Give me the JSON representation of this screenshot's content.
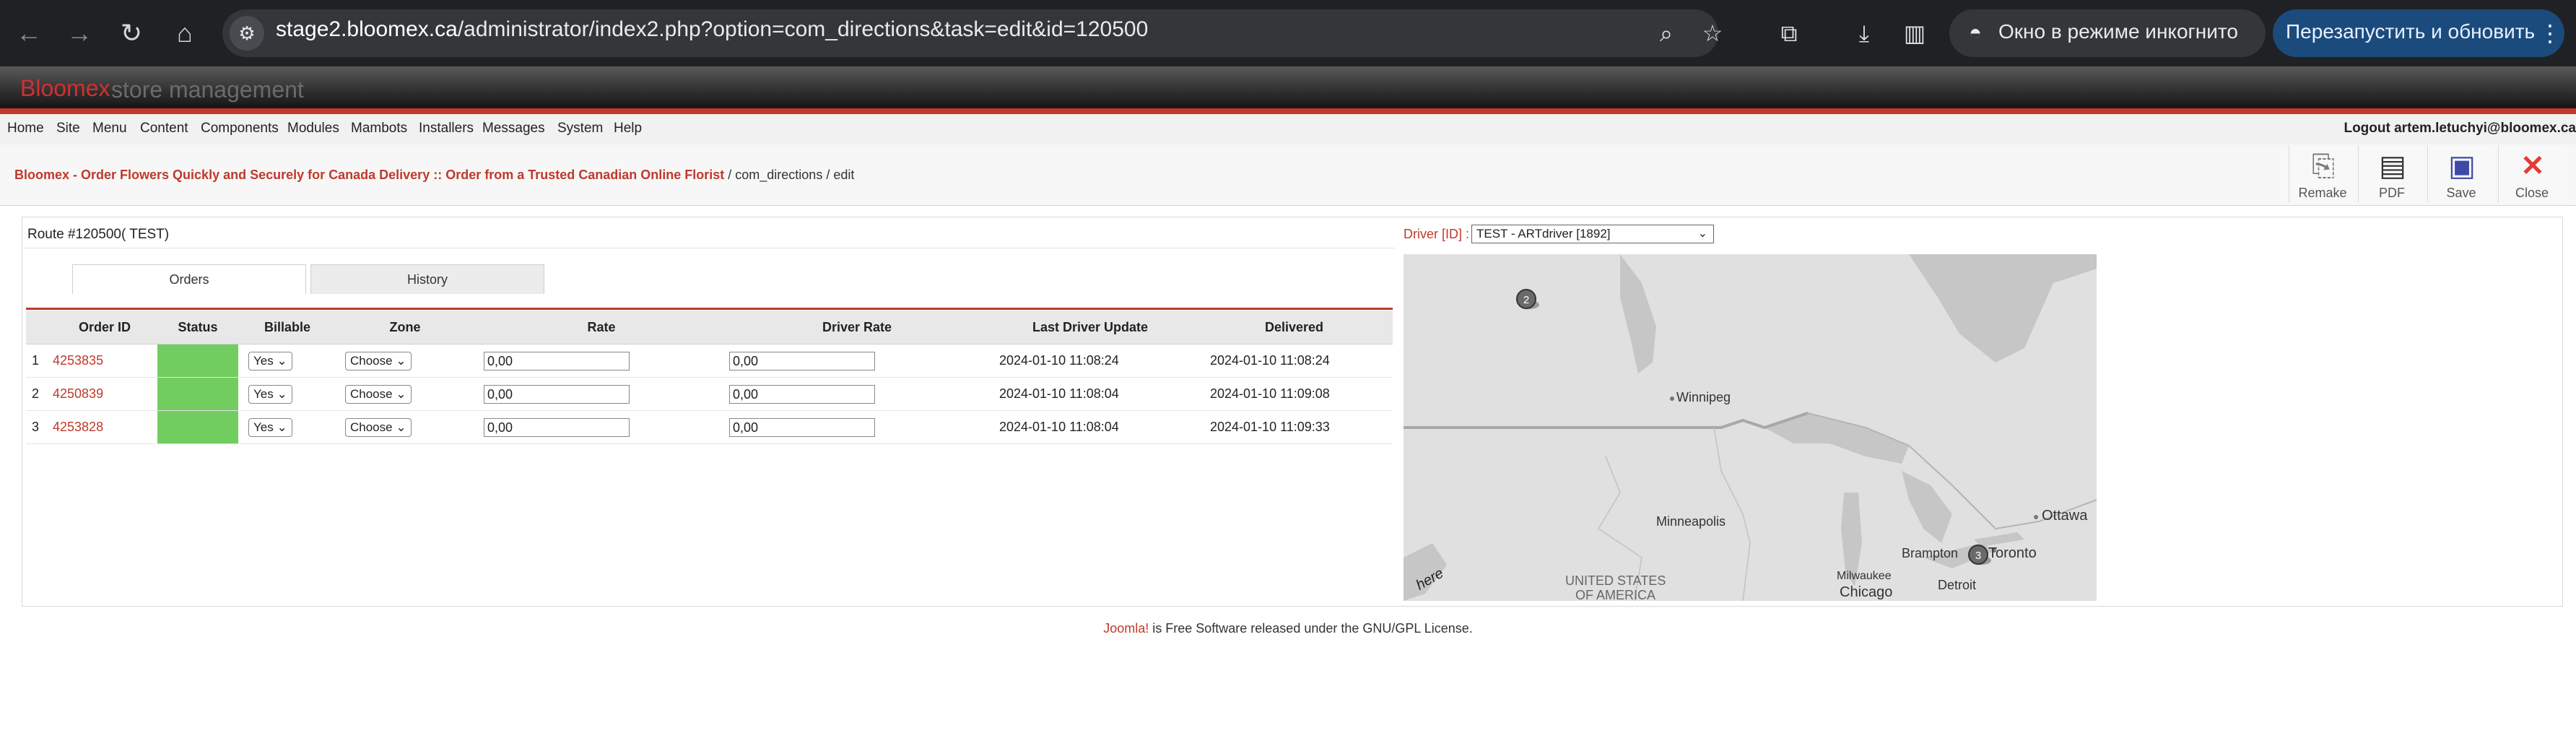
{
  "browser": {
    "url_host": "stage2.bloomex.ca",
    "url_path": "/administrator/index2.php?option=com_directions&task=edit&id=120500",
    "incognito_label": "Окно в режиме инкогнито",
    "relaunch_label": "Перезапустить и обновить"
  },
  "header": {
    "brand": "Bloomex",
    "brand_suffix": "store management"
  },
  "menu": {
    "items": [
      "Home",
      "Site",
      "Menu",
      "Content",
      "Components",
      "Modules",
      "Mambots",
      "Installers",
      "Messages",
      "System",
      "Help"
    ],
    "logout": "Logout artem.letuchyi@bloomex.ca"
  },
  "breadcrumb": {
    "site": "Bloomex - Order Flowers Quickly and Securely for Canada Delivery :: Order from a Trusted Canadian Online Florist",
    "path": " / com_directions / edit"
  },
  "toolbar": {
    "remake": "Remake",
    "pdf": "PDF",
    "save": "Save",
    "close": "Close"
  },
  "route": {
    "title": "Route #120500( TEST)",
    "tabs": [
      "Orders",
      "History"
    ]
  },
  "table": {
    "headers": [
      "Order ID",
      "Status",
      "Billable",
      "Zone",
      "Rate",
      "Driver Rate",
      "Last Driver Update",
      "Delivered"
    ],
    "rows": [
      {
        "num": "1",
        "order_id": "4253835",
        "billable": "Yes",
        "zone": "Choose",
        "rate": "0,00",
        "driver_rate": "0,00",
        "last_update": "2024-01-10 11:08:24",
        "delivered": "2024-01-10 11:08:24"
      },
      {
        "num": "2",
        "order_id": "4250839",
        "billable": "Yes",
        "zone": "Choose",
        "rate": "0,00",
        "driver_rate": "0,00",
        "last_update": "2024-01-10 11:08:04",
        "delivered": "2024-01-10 11:09:08"
      },
      {
        "num": "3",
        "order_id": "4253828",
        "billable": "Yes",
        "zone": "Choose",
        "rate": "0,00",
        "driver_rate": "0,00",
        "last_update": "2024-01-10 11:08:04",
        "delivered": "2024-01-10 11:09:33"
      }
    ]
  },
  "driver": {
    "label": "Driver [ID] :",
    "selected": "TEST - ARTdriver [1892]"
  },
  "map": {
    "labels": {
      "winnipeg": "Winnipeg",
      "ottawa": "Ottawa",
      "minneapolis": "Minneapolis",
      "usa1": "UNITED STATES",
      "usa2": "OF AMERICA",
      "milwaukee": "Milwaukee",
      "chicago": "Chicago",
      "brampton": "Brampton",
      "toronto": "Toronto",
      "detroit": "Detroit",
      "watermark": "here"
    },
    "marker_numbers": [
      "2",
      "3"
    ]
  },
  "footer": {
    "link": "Joomla!",
    "text": " is Free Software released under the GNU/GPL License."
  }
}
